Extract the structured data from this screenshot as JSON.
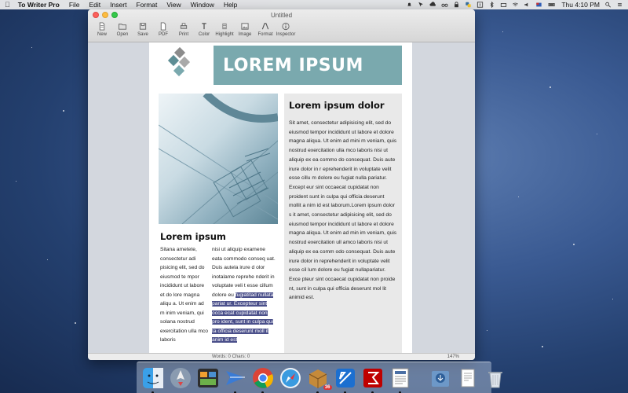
{
  "menubar": {
    "app_name": "To Writer Pro",
    "items": [
      "File",
      "Edit",
      "Insert",
      "Format",
      "View",
      "Window",
      "Help"
    ],
    "clock": "Thu 4:10 PM"
  },
  "window": {
    "title": "Untitled",
    "toolbar": [
      {
        "label": "New",
        "icon": "new-document-icon"
      },
      {
        "label": "Open",
        "icon": "folder-icon"
      },
      {
        "label": "Save",
        "icon": "save-icon"
      },
      {
        "label": "PDF",
        "icon": "pdf-icon"
      },
      {
        "label": "Print",
        "icon": "printer-icon"
      },
      {
        "label": "Color",
        "icon": "text-color-icon"
      },
      {
        "label": "Highlight",
        "icon": "highlight-icon"
      },
      {
        "label": "Image",
        "icon": "image-icon"
      },
      {
        "label": "Format",
        "icon": "format-icon"
      },
      {
        "label": "Inspector",
        "icon": "info-icon"
      }
    ]
  },
  "document": {
    "banner_title": "LOREM IPSUM",
    "left_heading": "Lorem ipsum",
    "col_a_text": "Sitana ametete, consectetur adi pisicing elit, sed do eiusmod te mpor incididunt ut labore et do lore magna aliqu a. Ut enim ad m inim veniam, qui solana nostrud exercitation ulla mco laboris",
    "col_b_text": "nisi ut aliquip examene eata commodo conseq uat. Duis autela irure d olor inotalame reprehe nderit in voluptate veli t esse cillum dolore eu ",
    "col_b_highlight": "fugiatitad nullata pariat ur. Excepteur sint occa ecat cupidatat non pro ident, sunt in culpa qui ta officia deserunt moll it anim id est",
    "side_heading": "Lorem ipsum dolor",
    "side_text": "Sit amet, consectetur adipisicing elit, sed do eiusmod tempor incididunt ut labore et dolore magna aliqua. Ut enim ad mini m veniam, quis nostrud exercitation ulla mco laboris nisi ut aliquip ex ea commo do consequat. Duis aute irure dolor in r eprehenderit in voluptate velit esse cillu m dolore eu fugiat nulla pariatur. Except eur sint occaecat cupidatat non proident sunt in culpa qui officia deserunt mollit a nim id est laborum.Lorem ipsum dolor s it amet, consectetur adipisicing elit, sed do eiusmod tempor incididunt ut labore et dolore magna aliqua. Ut enim ad min im veniam, quis nostrud exercitation ull amco laboris nisi ut aliquip ex ea comm odo consequat. Duis aute irure dolor in  reprehenderit in voluptate velit esse cil lum dolore eu fugiat nullapariatur. Exce pteur sint occaecat cupidatat non proide nt, sunt in culpa qui officia deserunt mol lit animid est."
  },
  "statusbar": {
    "counts": "Words: 0   Chars: 0",
    "zoom": "147%"
  },
  "dock": {
    "apps": [
      {
        "name": "finder-icon",
        "running": true
      },
      {
        "name": "launchpad-icon",
        "running": false
      },
      {
        "name": "mission-control-icon",
        "running": false
      },
      {
        "name": "paper-plane-icon",
        "running": true
      },
      {
        "name": "chrome-icon",
        "running": true
      },
      {
        "name": "safari-icon",
        "running": false
      },
      {
        "name": "box-app-icon",
        "running": true,
        "badge": "36"
      },
      {
        "name": "xcode-icon",
        "running": true
      },
      {
        "name": "filezilla-icon",
        "running": true
      },
      {
        "name": "to-writer-pro-icon",
        "running": true
      }
    ],
    "stacks": [
      {
        "name": "downloads-icon"
      },
      {
        "name": "documents-icon"
      },
      {
        "name": "trash-icon"
      }
    ]
  }
}
